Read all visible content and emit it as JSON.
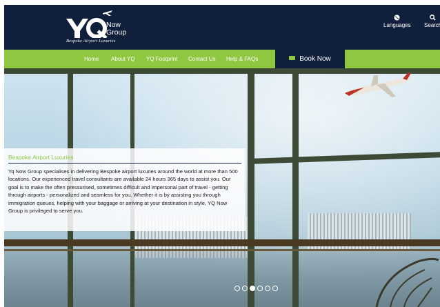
{
  "header": {
    "logo": {
      "monogram": "YQ",
      "line1": "Now",
      "line2": "Group",
      "tagline": "Bespoke Airport Luxuries"
    },
    "languages_label": "Languages",
    "search_label": "Search"
  },
  "nav": {
    "items": [
      {
        "label": "Home"
      },
      {
        "label": "About YQ"
      },
      {
        "label": "YQ Footprint"
      },
      {
        "label": "Contact Us"
      },
      {
        "label": "Help & FAQs"
      }
    ],
    "book_label": "Book Now"
  },
  "hero": {
    "title": "Bespoke Airport Luxuries",
    "text": "Yq Now Group specialises in delivering Bespoke airport luxuries around the world at more than 500 locations. Our experienced travel consultants are available 24 hours 365 days to assist you. Our goal is to make the often pressurised, sometimes difficult and impersonal part of travel - getting through airports - personalized and seamless for you. Whether it is by assisting you through immigration queues, helping with your baggage or arriving at your destination in style, YQ Now Group is privileged to serve you.",
    "slides": 6,
    "active_slide": 3
  },
  "colors": {
    "navy": "#0f1f3c",
    "green": "#8fc741"
  },
  "icons": [
    "globe-icon",
    "search-icon",
    "ticket-icon",
    "plane-icon"
  ]
}
